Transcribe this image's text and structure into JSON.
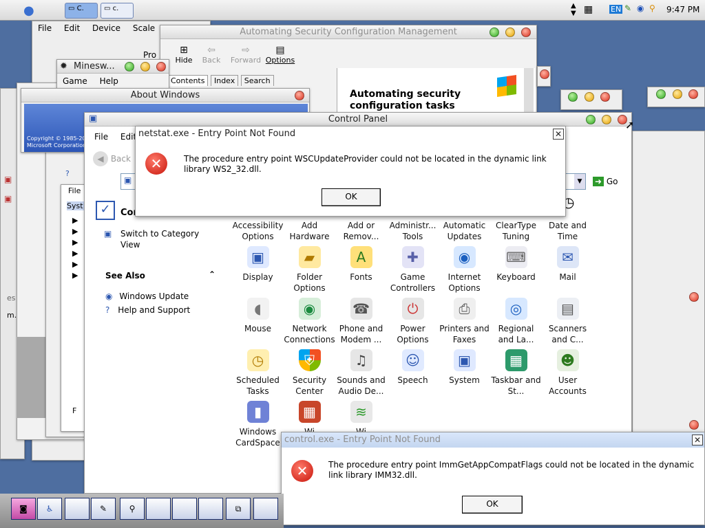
{
  "menubar": {
    "tabs": [
      "C.",
      "c."
    ],
    "lang": "EN",
    "clock": "9:47 PM"
  },
  "host_window": {
    "menu": [
      "File",
      "Edit",
      "Device",
      "Scale",
      "He"
    ]
  },
  "help_window": {
    "title": "Automating Security Configuration Management",
    "toolbar": {
      "hide": "Hide",
      "back": "Back",
      "forward": "Forward",
      "options": "Options"
    },
    "tabs": [
      "Contents",
      "Index",
      "Search"
    ],
    "heading": "Automating security configuration tasks"
  },
  "minesweeper": {
    "title": "Minesweeper",
    "title_visible": "Minesw...",
    "menu": [
      "Game",
      "Help"
    ]
  },
  "about_windows": {
    "title": "About Windows",
    "copyright_1": "Copyright © 1985-20",
    "copyright_2": "Microsoft Corporation"
  },
  "explorer_back": {
    "menu_file": "File",
    "tree_item": "Syst",
    "fragments": [
      "Pro",
      "Fil",
      "es",
      "m.",
      "F"
    ]
  },
  "control_panel": {
    "title": "Control Panel",
    "menu": [
      "File",
      "Edit"
    ],
    "back_label": "Back",
    "go_label": "Go",
    "side_heading": "Control Panel",
    "side_heading_visible": "Cor",
    "switch_view": "Switch to Category View",
    "see_also": "See Also",
    "links": [
      "Windows Update",
      "Help and Support"
    ],
    "items": [
      {
        "label": "Accessibility Options",
        "icon": "accessibility-icon"
      },
      {
        "label": "Add Hardware",
        "icon": "add-hardware-icon"
      },
      {
        "label": "Add or Remov...",
        "icon": "add-remove-programs-icon"
      },
      {
        "label": "Administr... Tools",
        "icon": "admin-tools-icon"
      },
      {
        "label": "Automatic Updates",
        "icon": "automatic-updates-icon"
      },
      {
        "label": "ClearType Tuning",
        "icon": "cleartype-icon"
      },
      {
        "label": "Date and Time",
        "icon": "date-time-icon"
      },
      {
        "label": "Display",
        "icon": "display-icon"
      },
      {
        "label": "Folder Options",
        "icon": "folder-options-icon"
      },
      {
        "label": "Fonts",
        "icon": "fonts-icon"
      },
      {
        "label": "Game Controllers",
        "icon": "game-controllers-icon"
      },
      {
        "label": "Internet Options",
        "icon": "internet-options-icon"
      },
      {
        "label": "Keyboard",
        "icon": "keyboard-icon"
      },
      {
        "label": "Mail",
        "icon": "mail-icon"
      },
      {
        "label": "Mouse",
        "icon": "mouse-icon"
      },
      {
        "label": "Network Connections",
        "icon": "network-icon"
      },
      {
        "label": "Phone and Modem ...",
        "icon": "phone-modem-icon"
      },
      {
        "label": "Power Options",
        "icon": "power-icon"
      },
      {
        "label": "Printers and Faxes",
        "icon": "printers-icon"
      },
      {
        "label": "Regional and La...",
        "icon": "regional-icon"
      },
      {
        "label": "Scanners and C...",
        "icon": "scanners-icon"
      },
      {
        "label": "Scheduled Tasks",
        "icon": "scheduled-tasks-icon"
      },
      {
        "label": "Security Center",
        "icon": "security-center-icon"
      },
      {
        "label": "Sounds and Audio De...",
        "icon": "sounds-icon"
      },
      {
        "label": "Speech",
        "icon": "speech-icon"
      },
      {
        "label": "System",
        "icon": "system-icon"
      },
      {
        "label": "Taskbar and St...",
        "icon": "taskbar-icon"
      },
      {
        "label": "User Accounts",
        "icon": "user-accounts-icon"
      },
      {
        "label": "Windows CardSpace",
        "icon": "cardspace-icon"
      },
      {
        "label": "Windows Firewall",
        "icon": "firewall-icon"
      },
      {
        "label": "Wireless Network",
        "icon": "wireless-icon"
      }
    ],
    "item_fragments": [
      "Wi",
      "Wi"
    ]
  },
  "netstat_error": {
    "title": "netstat.exe - Entry Point Not Found",
    "message": "The procedure entry point WSCUpdateProvider could not be located in the dynamic link library WS2_32.dll.",
    "ok": "OK"
  },
  "control_error": {
    "title": "control.exe - Entry Point Not Found",
    "message": "The procedure entry point ImmGetAppCompatFlags could not be located in the dynamic link library IMM32.dll.",
    "ok": "OK"
  },
  "colors": {
    "desktop": "#4e6ea0",
    "accent": "#8db2e8",
    "error": "#c7140a"
  }
}
